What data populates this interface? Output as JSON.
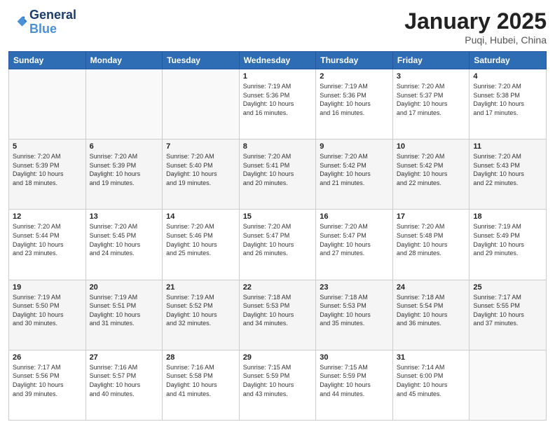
{
  "header": {
    "logo_line1": "General",
    "logo_line2": "Blue",
    "month_title": "January 2025",
    "location": "Puqi, Hubei, China"
  },
  "days_of_week": [
    "Sunday",
    "Monday",
    "Tuesday",
    "Wednesday",
    "Thursday",
    "Friday",
    "Saturday"
  ],
  "weeks": [
    [
      {
        "day": "",
        "info": ""
      },
      {
        "day": "",
        "info": ""
      },
      {
        "day": "",
        "info": ""
      },
      {
        "day": "1",
        "info": "Sunrise: 7:19 AM\nSunset: 5:36 PM\nDaylight: 10 hours\nand 16 minutes."
      },
      {
        "day": "2",
        "info": "Sunrise: 7:19 AM\nSunset: 5:36 PM\nDaylight: 10 hours\nand 16 minutes."
      },
      {
        "day": "3",
        "info": "Sunrise: 7:20 AM\nSunset: 5:37 PM\nDaylight: 10 hours\nand 17 minutes."
      },
      {
        "day": "4",
        "info": "Sunrise: 7:20 AM\nSunset: 5:38 PM\nDaylight: 10 hours\nand 17 minutes."
      }
    ],
    [
      {
        "day": "5",
        "info": "Sunrise: 7:20 AM\nSunset: 5:39 PM\nDaylight: 10 hours\nand 18 minutes."
      },
      {
        "day": "6",
        "info": "Sunrise: 7:20 AM\nSunset: 5:39 PM\nDaylight: 10 hours\nand 19 minutes."
      },
      {
        "day": "7",
        "info": "Sunrise: 7:20 AM\nSunset: 5:40 PM\nDaylight: 10 hours\nand 19 minutes."
      },
      {
        "day": "8",
        "info": "Sunrise: 7:20 AM\nSunset: 5:41 PM\nDaylight: 10 hours\nand 20 minutes."
      },
      {
        "day": "9",
        "info": "Sunrise: 7:20 AM\nSunset: 5:42 PM\nDaylight: 10 hours\nand 21 minutes."
      },
      {
        "day": "10",
        "info": "Sunrise: 7:20 AM\nSunset: 5:42 PM\nDaylight: 10 hours\nand 22 minutes."
      },
      {
        "day": "11",
        "info": "Sunrise: 7:20 AM\nSunset: 5:43 PM\nDaylight: 10 hours\nand 22 minutes."
      }
    ],
    [
      {
        "day": "12",
        "info": "Sunrise: 7:20 AM\nSunset: 5:44 PM\nDaylight: 10 hours\nand 23 minutes."
      },
      {
        "day": "13",
        "info": "Sunrise: 7:20 AM\nSunset: 5:45 PM\nDaylight: 10 hours\nand 24 minutes."
      },
      {
        "day": "14",
        "info": "Sunrise: 7:20 AM\nSunset: 5:46 PM\nDaylight: 10 hours\nand 25 minutes."
      },
      {
        "day": "15",
        "info": "Sunrise: 7:20 AM\nSunset: 5:47 PM\nDaylight: 10 hours\nand 26 minutes."
      },
      {
        "day": "16",
        "info": "Sunrise: 7:20 AM\nSunset: 5:47 PM\nDaylight: 10 hours\nand 27 minutes."
      },
      {
        "day": "17",
        "info": "Sunrise: 7:20 AM\nSunset: 5:48 PM\nDaylight: 10 hours\nand 28 minutes."
      },
      {
        "day": "18",
        "info": "Sunrise: 7:19 AM\nSunset: 5:49 PM\nDaylight: 10 hours\nand 29 minutes."
      }
    ],
    [
      {
        "day": "19",
        "info": "Sunrise: 7:19 AM\nSunset: 5:50 PM\nDaylight: 10 hours\nand 30 minutes."
      },
      {
        "day": "20",
        "info": "Sunrise: 7:19 AM\nSunset: 5:51 PM\nDaylight: 10 hours\nand 31 minutes."
      },
      {
        "day": "21",
        "info": "Sunrise: 7:19 AM\nSunset: 5:52 PM\nDaylight: 10 hours\nand 32 minutes."
      },
      {
        "day": "22",
        "info": "Sunrise: 7:18 AM\nSunset: 5:53 PM\nDaylight: 10 hours\nand 34 minutes."
      },
      {
        "day": "23",
        "info": "Sunrise: 7:18 AM\nSunset: 5:53 PM\nDaylight: 10 hours\nand 35 minutes."
      },
      {
        "day": "24",
        "info": "Sunrise: 7:18 AM\nSunset: 5:54 PM\nDaylight: 10 hours\nand 36 minutes."
      },
      {
        "day": "25",
        "info": "Sunrise: 7:17 AM\nSunset: 5:55 PM\nDaylight: 10 hours\nand 37 minutes."
      }
    ],
    [
      {
        "day": "26",
        "info": "Sunrise: 7:17 AM\nSunset: 5:56 PM\nDaylight: 10 hours\nand 39 minutes."
      },
      {
        "day": "27",
        "info": "Sunrise: 7:16 AM\nSunset: 5:57 PM\nDaylight: 10 hours\nand 40 minutes."
      },
      {
        "day": "28",
        "info": "Sunrise: 7:16 AM\nSunset: 5:58 PM\nDaylight: 10 hours\nand 41 minutes."
      },
      {
        "day": "29",
        "info": "Sunrise: 7:15 AM\nSunset: 5:59 PM\nDaylight: 10 hours\nand 43 minutes."
      },
      {
        "day": "30",
        "info": "Sunrise: 7:15 AM\nSunset: 5:59 PM\nDaylight: 10 hours\nand 44 minutes."
      },
      {
        "day": "31",
        "info": "Sunrise: 7:14 AM\nSunset: 6:00 PM\nDaylight: 10 hours\nand 45 minutes."
      },
      {
        "day": "",
        "info": ""
      }
    ]
  ]
}
